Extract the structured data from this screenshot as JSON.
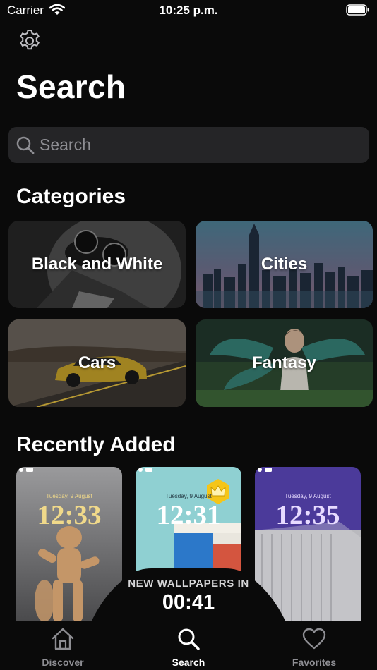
{
  "status_bar": {
    "carrier": "Carrier",
    "time": "10:25 p.m."
  },
  "header": {
    "title": "Search",
    "settings_icon": "gear-icon"
  },
  "search": {
    "placeholder": "Search",
    "value": ""
  },
  "categories": {
    "title": "Categories",
    "items": [
      {
        "label": "Black and White"
      },
      {
        "label": "Cities"
      },
      {
        "label": "Cars"
      },
      {
        "label": "Fantasy"
      }
    ]
  },
  "recently_added": {
    "title": "Recently Added",
    "items": [
      {
        "date": "Tuesday, 9 August",
        "time": "12:33",
        "time_color": "#f0d98a",
        "premium": false
      },
      {
        "date": "Tuesday, 9 August",
        "time": "12:31",
        "time_color": "#ffffff",
        "premium": true
      },
      {
        "date": "Tuesday, 9 August",
        "time": "12:35",
        "time_color": "#e7dbff",
        "premium": false
      }
    ]
  },
  "timer": {
    "label": "NEW WALLPAPERS IN",
    "value": "00:41"
  },
  "tab_bar": {
    "active": "Search",
    "items": [
      {
        "label": "Discover",
        "icon": "house-icon"
      },
      {
        "label": "Search",
        "icon": "search-icon"
      },
      {
        "label": "Favorites",
        "icon": "heart-icon"
      }
    ]
  },
  "colors": {
    "background": "#0a0a0a",
    "search_field": "#252527",
    "inactive_tab": "#8e8e93",
    "premium_badge": "#f5c518"
  }
}
